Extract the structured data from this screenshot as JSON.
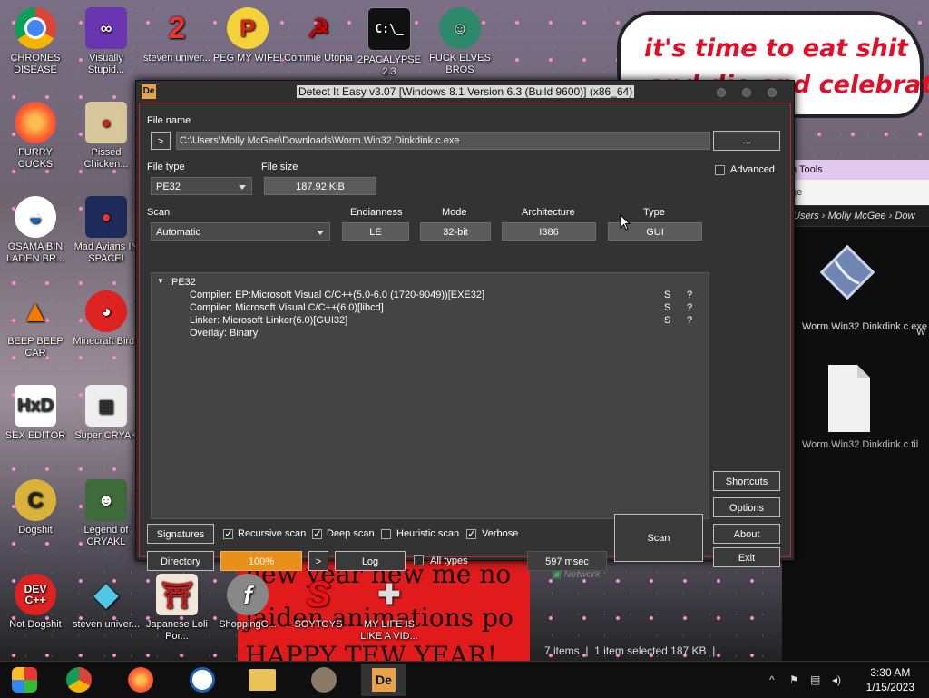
{
  "wallpaper": {
    "note_line1": "it's time to eat shit",
    "note_line2": "and die and celebrate",
    "red_line1": "new year new me no",
    "red_line2": "jaiden animations po",
    "red_line3": "HAPPY TEW YEAR!"
  },
  "desktop_icons": [
    {
      "label": "CHRONES DISEASE",
      "icon": "chrome-icon"
    },
    {
      "label": "Visually Stupid...",
      "icon": "visual-studio-icon"
    },
    {
      "label": "steven univer...",
      "icon": "number-two-icon"
    },
    {
      "label": "PEG MY WIFE!",
      "icon": "p-logo-icon"
    },
    {
      "label": "Commie Utopia",
      "icon": "hammer-sickle-icon"
    },
    {
      "label": "2PACALYPSE 2.3",
      "icon": "console-icon"
    },
    {
      "label": "FUCK ELVES BROS",
      "icon": "elf-icon"
    },
    {
      "label": "FURRY CUCKS",
      "icon": "firefox-icon"
    },
    {
      "label": "Pissed Chicken...",
      "icon": "angry-birds-icon"
    },
    {
      "label": "OSAMA BIN LADEN BR...",
      "icon": "obama-logo-icon"
    },
    {
      "label": "Mad Avians IN SPACE!",
      "icon": "angry-birds-space-icon"
    },
    {
      "label": "BEEP BEEP CAR",
      "icon": "vlc-icon"
    },
    {
      "label": "Minecraft Birds",
      "icon": "angry-bird-icon"
    },
    {
      "label": "SEX EDITOR",
      "icon": "hxd-icon"
    },
    {
      "label": "Super CRYAK",
      "icon": "pixel-character-icon"
    },
    {
      "label": "Dogshit",
      "icon": "c-logo-icon"
    },
    {
      "label": "Legend of CRYAKL",
      "icon": "game-character-icon"
    },
    {
      "label": "Not Dogshit",
      "icon": "dev-cpp-icon"
    },
    {
      "label": "steven univer...",
      "icon": "diamond-icon"
    },
    {
      "label": "Japanese Loli Por...",
      "icon": "torii-icon"
    },
    {
      "label": "ShoppingC...",
      "icon": "flash-icon"
    },
    {
      "label": "SOYTOYS",
      "icon": "s-logo-icon"
    },
    {
      "label": "MY LIFE IS LIKE A VID...",
      "icon": "gamepad-icon"
    }
  ],
  "explorer": {
    "ribbon_tab": "n Tools",
    "ribbon_sub": "ge",
    "address": "Users  ›  Molly McGee  ›  Dow",
    "file1": "Worm.Win32.Dinkdink.c.exe",
    "file2": "Worm.Win32.Dinkdink.c.til",
    "file3_partial": "W",
    "nav_network": "Network",
    "status_items": "7 items",
    "status_selected": "1 item selected  187 KB"
  },
  "die": {
    "title": "Detect It Easy v3.07 [Windows 8.1 Version 6.3 (Build 9600)] (x86_64)",
    "file_name_label": "File name",
    "file_path": "C:\\Users\\Molly McGee\\Downloads\\Worm.Win32.Dinkdink.c.exe",
    "nav_arrow": ">",
    "browse_button": "...",
    "file_type_label": "File type",
    "file_type_value": "PE32",
    "file_size_label": "File size",
    "file_size_value": "187.92 KiB",
    "advanced_label": "Advanced",
    "scan_label": "Scan",
    "scan_value": "Automatic",
    "endianness_label": "Endianness",
    "endianness_value": "LE",
    "mode_label": "Mode",
    "mode_value": "32-bit",
    "architecture_label": "Architecture",
    "architecture_value": "I386",
    "type_label": "Type",
    "type_value": "GUI",
    "results_root": "PE32",
    "results": [
      {
        "text": "Compiler: EP:Microsoft Visual C/C++(5.0-6.0 (1720-9049))[EXE32]",
        "s": "S",
        "q": "?"
      },
      {
        "text": "Compiler: Microsoft Visual C/C++(6.0)[libcd]",
        "s": "S",
        "q": "?"
      },
      {
        "text": "Linker: Microsoft Linker(6.0)[GUI32]",
        "s": "S",
        "q": "?"
      },
      {
        "text": "Overlay: Binary",
        "s": "",
        "q": ""
      }
    ],
    "side_buttons": {
      "shortcuts": "Shortcuts",
      "options": "Options",
      "about": "About",
      "exit": "Exit"
    },
    "signatures_button": "Signatures",
    "recursive_scan": "Recursive scan",
    "deep_scan": "Deep scan",
    "heuristic_scan": "Heuristic scan",
    "verbose": "Verbose",
    "directory_button": "Directory",
    "progress": "100%",
    "progress_arrow": ">",
    "log_button": "Log",
    "all_types": "All types",
    "elapsed": "597 msec",
    "scan_button": "Scan"
  },
  "taskbar": {
    "time": "3:30 AM",
    "date": "1/15/2023",
    "tray_up": "^"
  },
  "colors": {
    "accent_border": "#c0282e",
    "progress": "#e8901a"
  }
}
